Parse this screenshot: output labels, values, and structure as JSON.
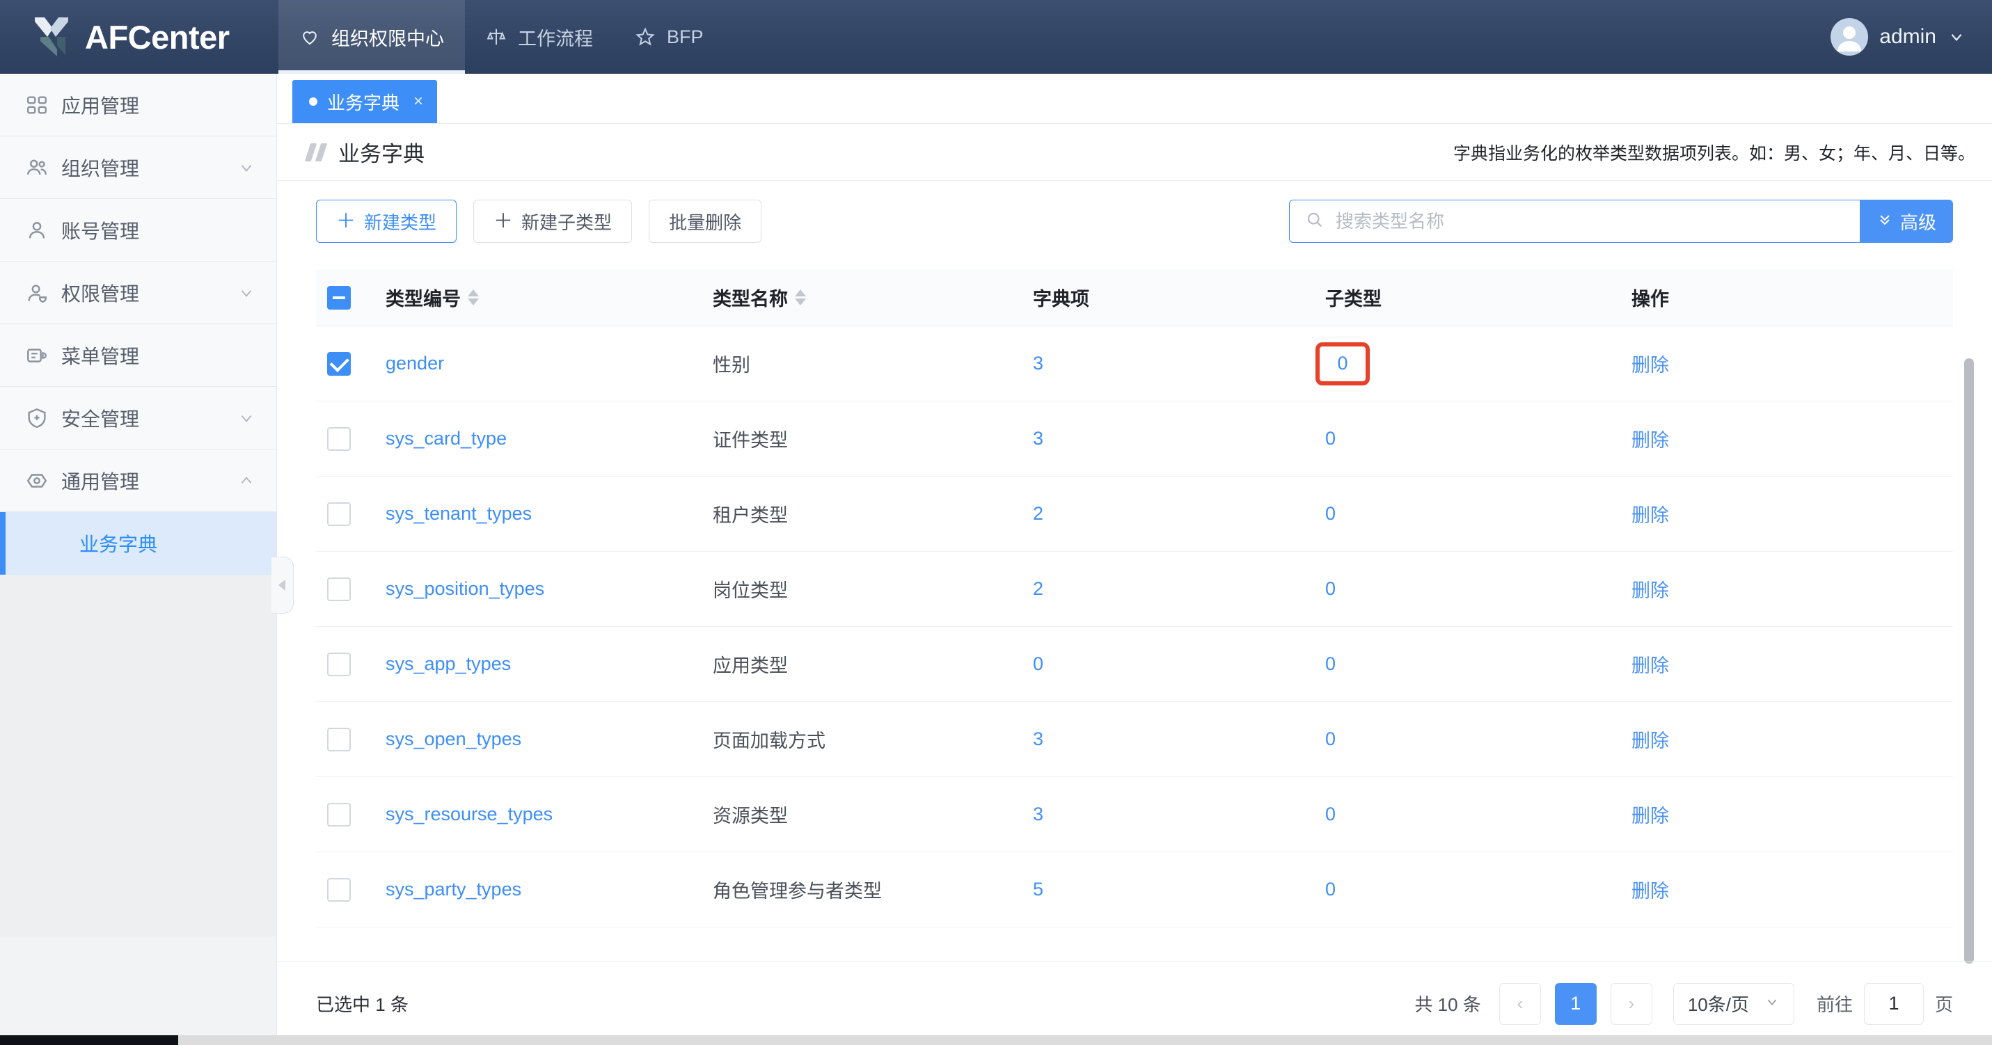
{
  "topbar": {
    "brand": "AFCenter",
    "nav": [
      {
        "label": "组织权限中心",
        "icon": "heart-icon",
        "active": true
      },
      {
        "label": "工作流程",
        "icon": "workflow-icon",
        "active": false
      },
      {
        "label": "BFP",
        "icon": "star-icon",
        "active": false
      }
    ],
    "user": "admin"
  },
  "sidebar": {
    "items": [
      {
        "label": "应用管理",
        "icon": "apps-grid-icon",
        "expandable": false
      },
      {
        "label": "组织管理",
        "icon": "org-users-icon",
        "expandable": true,
        "expanded": false
      },
      {
        "label": "账号管理",
        "icon": "user-icon",
        "expandable": false
      },
      {
        "label": "权限管理",
        "icon": "user-shield-icon",
        "expandable": true,
        "expanded": false
      },
      {
        "label": "菜单管理",
        "icon": "menu-list-icon",
        "expandable": false
      },
      {
        "label": "安全管理",
        "icon": "shield-plus-icon",
        "expandable": true,
        "expanded": false
      },
      {
        "label": "通用管理",
        "icon": "eye-hex-icon",
        "expandable": true,
        "expanded": true
      }
    ],
    "sub_item": {
      "label": "业务字典",
      "active": true
    }
  },
  "tabs": [
    {
      "label": "业务字典",
      "active": true,
      "close": "×"
    }
  ],
  "page_header": {
    "title": "业务字典",
    "description": "字典指业务化的枚举类型数据项列表。如：男、女；年、月、日等。"
  },
  "toolbar": {
    "new_type_label": "新建类型",
    "new_subtype_label": "新建子类型",
    "batch_delete_label": "批量删除",
    "plus": "＋"
  },
  "search": {
    "placeholder": "搜索类型名称",
    "value": "",
    "advanced_label": "高级"
  },
  "table": {
    "headers": {
      "code": "类型编号",
      "name": "类型名称",
      "items": "字典项",
      "subtype": "子类型",
      "operation": "操作"
    },
    "select_all_state": "indeterminate",
    "delete_label": "删除",
    "rows": [
      {
        "checked": true,
        "code": "gender",
        "name": "性别",
        "items": "3",
        "subtype": "0",
        "highlight": true
      },
      {
        "checked": false,
        "code": "sys_card_type",
        "name": "证件类型",
        "items": "3",
        "subtype": "0",
        "highlight": false
      },
      {
        "checked": false,
        "code": "sys_tenant_types",
        "name": "租户类型",
        "items": "2",
        "subtype": "0",
        "highlight": false
      },
      {
        "checked": false,
        "code": "sys_position_types",
        "name": "岗位类型",
        "items": "2",
        "subtype": "0",
        "highlight": false
      },
      {
        "checked": false,
        "code": "sys_app_types",
        "name": "应用类型",
        "items": "0",
        "subtype": "0",
        "highlight": false
      },
      {
        "checked": false,
        "code": "sys_open_types",
        "name": "页面加载方式",
        "items": "3",
        "subtype": "0",
        "highlight": false
      },
      {
        "checked": false,
        "code": "sys_resourse_types",
        "name": "资源类型",
        "items": "3",
        "subtype": "0",
        "highlight": false
      },
      {
        "checked": false,
        "code": "sys_party_types",
        "name": "角色管理参与者类型",
        "items": "5",
        "subtype": "0",
        "highlight": false
      }
    ]
  },
  "footer": {
    "selected_text": "已选中 1 条",
    "total_text": "共 10 条",
    "prev": "‹",
    "next": "›",
    "current_page": "1",
    "page_size": "10条/页",
    "goto_label": "前往",
    "goto_value": "1",
    "page_unit": "页"
  },
  "colors": {
    "accent": "#3d8ef7",
    "topbar": "#334666",
    "highlight": "#e8412a",
    "sidebar_active_bg": "#dceafb"
  }
}
